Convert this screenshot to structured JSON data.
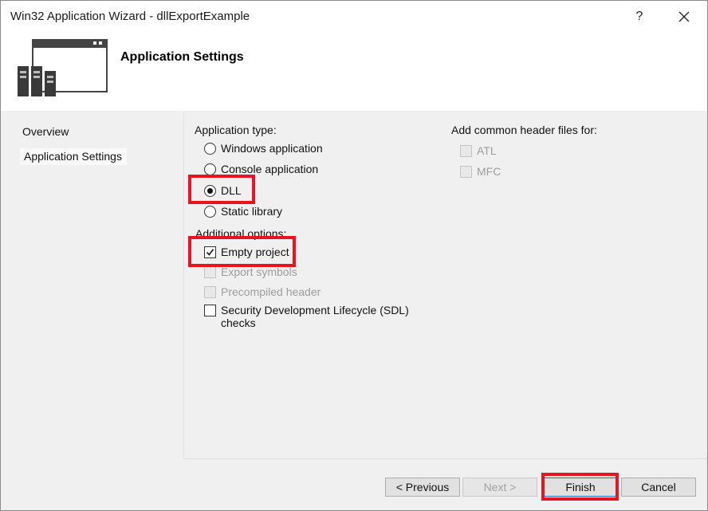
{
  "window": {
    "title": "Win32 Application Wizard - dllExportExample",
    "help": "?"
  },
  "header": {
    "title": "Application Settings"
  },
  "nav": {
    "items": [
      {
        "label": "Overview"
      },
      {
        "label": "Application Settings"
      }
    ]
  },
  "app_type": {
    "heading": "Application type:",
    "options": [
      {
        "label": "Windows application",
        "selected": false
      },
      {
        "label": "Console application",
        "selected": false
      },
      {
        "label": "DLL",
        "selected": true
      },
      {
        "label": "Static library",
        "selected": false
      }
    ]
  },
  "additional": {
    "heading": "Additional options:",
    "options": [
      {
        "label": "Empty project",
        "checked": true,
        "enabled": true
      },
      {
        "label": "Export symbols",
        "checked": false,
        "enabled": false
      },
      {
        "label": "Precompiled header",
        "checked": false,
        "enabled": false
      },
      {
        "label": "Security Development Lifecycle (SDL)",
        "label2": "checks",
        "checked": false,
        "enabled": true
      }
    ]
  },
  "common_headers": {
    "heading": "Add common header files for:",
    "options": [
      {
        "label": "ATL",
        "checked": false,
        "enabled": false
      },
      {
        "label": "MFC",
        "checked": false,
        "enabled": false
      }
    ]
  },
  "buttons": {
    "previous": "< Previous",
    "next": "Next >",
    "finish": "Finish",
    "cancel": "Cancel"
  },
  "colors": {
    "highlight": "#e8141f",
    "panel": "#f0f0f0"
  }
}
